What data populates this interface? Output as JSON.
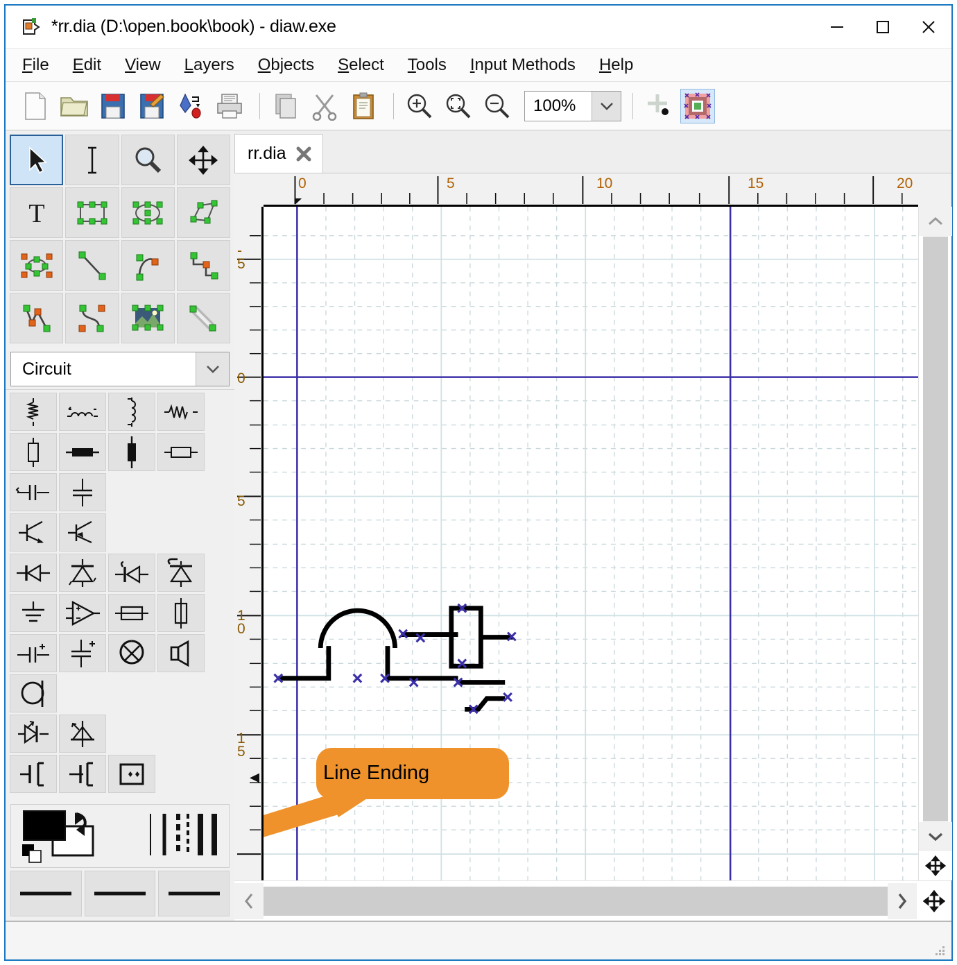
{
  "window": {
    "title": "*rr.dia (D:\\open.book\\book) - diaw.exe",
    "icon": "dia-document-icon",
    "controls": [
      {
        "name": "minimize-button",
        "glyph": "minimize-icon"
      },
      {
        "name": "maximize-button",
        "glyph": "maximize-icon"
      },
      {
        "name": "close-button",
        "glyph": "close-icon"
      }
    ]
  },
  "menubar": {
    "items": [
      {
        "label": "File",
        "mnemonic": "F"
      },
      {
        "label": "Edit",
        "mnemonic": "E"
      },
      {
        "label": "View",
        "mnemonic": "V"
      },
      {
        "label": "Layers",
        "mnemonic": "L"
      },
      {
        "label": "Objects",
        "mnemonic": "O"
      },
      {
        "label": "Select",
        "mnemonic": "S"
      },
      {
        "label": "Tools",
        "mnemonic": "T"
      },
      {
        "label": "Input Methods",
        "mnemonic": "I"
      },
      {
        "label": "Help",
        "mnemonic": "H"
      }
    ]
  },
  "toolbar": {
    "buttons": [
      {
        "name": "new-button",
        "icon": "new-document-icon",
        "tooltip": "New"
      },
      {
        "name": "open-button",
        "icon": "open-folder-icon",
        "tooltip": "Open"
      },
      {
        "name": "save-button",
        "icon": "save-floppy-icon",
        "tooltip": "Save"
      },
      {
        "name": "save-as-button",
        "icon": "save-as-floppy-pencil-icon",
        "tooltip": "Save As"
      },
      {
        "name": "export-button",
        "icon": "export-icon",
        "tooltip": "Export"
      },
      {
        "name": "print-button",
        "icon": "printer-icon",
        "tooltip": "Print"
      },
      {
        "name": "copy-button",
        "icon": "copy-icon",
        "tooltip": "Copy"
      },
      {
        "name": "cut-button",
        "icon": "scissors-icon",
        "tooltip": "Cut"
      },
      {
        "name": "paste-button",
        "icon": "clipboard-icon",
        "tooltip": "Paste"
      },
      {
        "name": "zoom-in-button",
        "icon": "magnifier-plus-icon",
        "tooltip": "Zoom In"
      },
      {
        "name": "zoom-fit-button",
        "icon": "magnifier-fit-icon",
        "tooltip": "Zoom to Fit"
      },
      {
        "name": "zoom-out-button",
        "icon": "magnifier-minus-icon",
        "tooltip": "Zoom Out"
      }
    ],
    "zoom": {
      "value": "100%",
      "arrow": "chevron-down-icon"
    },
    "snap_to_grid": {
      "name": "snap-to-grid-button",
      "icon": "grid-snap-icon",
      "active": false
    },
    "snap_to_object": {
      "name": "snap-to-object-button",
      "icon": "object-snap-icon",
      "active": true
    }
  },
  "tool_palette": {
    "tools": [
      {
        "label": "Modify object(s)",
        "icon": "arrow-pointer-icon",
        "selected": true
      },
      {
        "label": "Edit text",
        "icon": "text-caret-icon",
        "selected": false
      },
      {
        "label": "Magnify",
        "icon": "magnifier-icon",
        "selected": false
      },
      {
        "label": "Scroll the view",
        "icon": "move-cross-icon",
        "selected": false
      },
      {
        "label": "Text",
        "icon": "text-T-icon",
        "selected": false
      },
      {
        "label": "Box",
        "icon": "box-shape-icon",
        "selected": false
      },
      {
        "label": "Ellipse",
        "icon": "ellipse-shape-icon",
        "selected": false
      },
      {
        "label": "Polygon",
        "icon": "polygon-shape-icon",
        "selected": false
      },
      {
        "label": "Beziergon",
        "icon": "beziergon-shape-icon",
        "selected": false
      },
      {
        "label": "Line",
        "icon": "line-icon",
        "selected": false
      },
      {
        "label": "Arc",
        "icon": "arc-icon",
        "selected": false
      },
      {
        "label": "Zigzagline",
        "icon": "zigzagline-icon",
        "selected": false
      },
      {
        "label": "Polyline",
        "icon": "polyline-icon",
        "selected": false
      },
      {
        "label": "Bezierline",
        "icon": "bezierline-icon",
        "selected": false
      },
      {
        "label": "Image",
        "icon": "image-icon",
        "selected": false
      },
      {
        "label": "Outline",
        "icon": "outline-icon",
        "selected": false
      }
    ]
  },
  "sheet": {
    "selected": "Circuit",
    "arrow": "chevron-down-icon",
    "shapes": [
      {
        "label": "Vertical Resistor",
        "icon": "circuit-vresistor-icon"
      },
      {
        "label": "Horizontal Inductor",
        "icon": "circuit-hinductor-icon"
      },
      {
        "label": "Vertical Inductor",
        "icon": "circuit-vinductor-icon"
      },
      {
        "label": "Horizontal Resistor",
        "icon": "circuit-hresistor-icon"
      },
      {
        "label": "Vertical Resistor (IEC)",
        "icon": "circuit-vresistor-iec-icon"
      },
      {
        "label": "Horizontal Inductor (IEC)",
        "icon": "circuit-hinductor-iec-icon"
      },
      {
        "label": "Vertical Inductor (IEC)",
        "icon": "circuit-vinductor-iec-icon"
      },
      {
        "label": "Horizontal Resistor (IEC)",
        "icon": "circuit-hresistor-iec-icon"
      },
      {
        "label": "Horizontal Capacitor",
        "icon": "circuit-hcapacitor-icon"
      },
      {
        "label": "Vertical Capacitor",
        "icon": "circuit-vcapacitor-icon"
      },
      {
        "label": "NPN Transistor",
        "icon": "circuit-npn-icon"
      },
      {
        "label": "PNP Transistor",
        "icon": "circuit-pnp-icon"
      },
      {
        "label": "Horizontal Diode",
        "icon": "circuit-hdiode-icon"
      },
      {
        "label": "Vertical Zener Diode",
        "icon": "circuit-vzener-icon"
      },
      {
        "label": "Horizontal Diode (LED)",
        "icon": "circuit-hled-icon"
      },
      {
        "label": "Vertical Zener (alt)",
        "icon": "circuit-vzener2-icon"
      },
      {
        "label": "Ground",
        "icon": "circuit-ground-icon"
      },
      {
        "label": "Op Amp",
        "icon": "circuit-opamp-icon"
      },
      {
        "label": "Horizontal Fuse",
        "icon": "circuit-hfuse-icon"
      },
      {
        "label": "Vertical Fuse",
        "icon": "circuit-vfuse-icon"
      },
      {
        "label": "Horizontal Electrolytic Capacitor",
        "icon": "circuit-hecapacitor-icon"
      },
      {
        "label": "Vertical Electrolytic Capacitor",
        "icon": "circuit-vecapacitor-icon"
      },
      {
        "label": "Lamp",
        "icon": "circuit-lamp-icon"
      },
      {
        "label": "Speaker",
        "icon": "circuit-speaker-icon"
      },
      {
        "label": "Microphone",
        "icon": "circuit-microphone-icon"
      },
      {
        "label": "Horizontal LED 2",
        "icon": "circuit-hled2-icon"
      },
      {
        "label": "Vertical LED 2",
        "icon": "circuit-vled2-icon"
      },
      {
        "label": "NMOS Transistor",
        "icon": "circuit-nmos-icon"
      },
      {
        "label": "PMOS Transistor",
        "icon": "circuit-pmos-icon"
      },
      {
        "label": "Connector",
        "icon": "circuit-connector-icon"
      }
    ]
  },
  "style_panel": {
    "foreground_color": "#000000",
    "background_color": "#ffffff",
    "swap_icon": "swap-colors-icon",
    "reset_icon": "default-colors-icon",
    "line_style_name": "line-style-selector",
    "line_endings": [
      {
        "name": "line-end-start-button",
        "icon": "line-ending-start-icon"
      },
      {
        "name": "line-end-middle-button",
        "icon": "line-ending-middle-icon"
      },
      {
        "name": "line-end-finish-button",
        "icon": "line-ending-finish-icon"
      }
    ]
  },
  "tabs": [
    {
      "label": "rr.dia",
      "close_icon": "close-tab-icon",
      "active": true
    }
  ],
  "canvas": {
    "h_ruler_labels": [
      "0",
      "5",
      "10",
      "15",
      "20"
    ],
    "v_ruler_labels": [
      "-5",
      "0",
      "5",
      "10",
      "15"
    ],
    "grid_color": "#c6d5d8",
    "guide_color": "#cde0e4",
    "page_boundary_color": "#3a2fa8",
    "handle_color": "#3a2fa8",
    "objects": [
      {
        "name": "wire-with-hop",
        "type": "zigzagline-with-arch"
      },
      {
        "name": "wire-horizontal",
        "type": "line"
      },
      {
        "name": "component-rectangle",
        "type": "box"
      },
      {
        "name": "wire-into-component",
        "type": "line"
      },
      {
        "name": "wire-out-of-component",
        "type": "line"
      },
      {
        "name": "wire-with-step",
        "type": "zigzagline"
      }
    ]
  },
  "callout": {
    "text": "Line Ending",
    "fill": "#f0922b",
    "text_color": "#000000"
  },
  "scrollbars": {
    "vertical": {
      "up_icon": "chevron-up-icon",
      "down_icon": "chevron-down-icon",
      "nav_icon": "pan-navigate-icon"
    },
    "horizontal": {
      "left_icon": "chevron-left-icon",
      "right_icon": "chevron-right-icon",
      "nav_icon": "pan-navigate-icon"
    }
  },
  "statusbar": {
    "grip": "resize-grip-icon"
  }
}
